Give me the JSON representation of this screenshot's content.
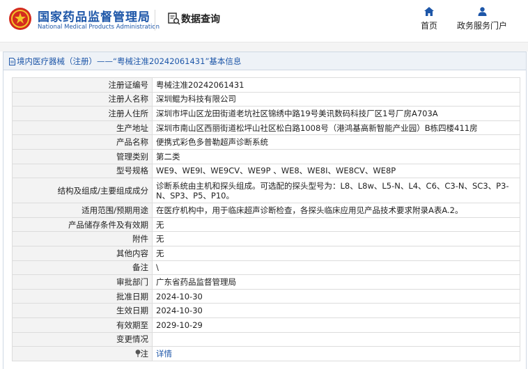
{
  "header": {
    "brand_cn": "国家药品监督管理局",
    "brand_en": "National Medical Products Administration",
    "data_query": "数据查询",
    "nav": [
      {
        "label": "首页",
        "icon": "home-icon"
      },
      {
        "label": "政务服务门户",
        "icon": "user-icon"
      }
    ],
    "accent": "#1d56a8"
  },
  "panel": {
    "title": "境内医疗器械（注册）——“粤械注准20242061431”基本信息"
  },
  "rows": [
    {
      "label": "注册证编号",
      "value": "粤械注准20242061431"
    },
    {
      "label": "注册人名称",
      "value": "深圳鲲为科技有限公司"
    },
    {
      "label": "注册人住所",
      "value": "深圳市坪山区龙田街道老坑社区锦绣中路19号美讯数码科技厂区1号厂房A703A"
    },
    {
      "label": "生产地址",
      "value": "深圳市南山区西丽街道松坪山社区松白路1008号（港鸿基高新智能产业园）B栋四楼411房"
    },
    {
      "label": "产品名称",
      "value": "便携式彩色多普勒超声诊断系统"
    },
    {
      "label": "管理类别",
      "value": "第二类"
    },
    {
      "label": "型号规格",
      "value": "WE9、WE9I、WE9CV、WE9P 、WE8、WE8I、WE8CV、WE8P"
    },
    {
      "label": "结构及组成/主要组成成分",
      "value": "诊断系统由主机和探头组成。可选配的探头型号为：L8、L8w、L5-N、L4、C6、C3-N、SC3、P3-N、SP3、P5、P10。"
    },
    {
      "label": "适用范围/预期用途",
      "value": "在医疗机构中，用于临床超声诊断检查，各探头临床应用见产品技术要求附录A表A.2。"
    },
    {
      "label": "产品储存条件及有效期",
      "value": "无"
    },
    {
      "label": "附件",
      "value": "无"
    },
    {
      "label": "其他内容",
      "value": "无"
    },
    {
      "label": "备注",
      "value": "\\"
    },
    {
      "label": "审批部门",
      "value": "广东省药品监督管理局"
    },
    {
      "label": "批准日期",
      "value": "2024-10-30"
    },
    {
      "label": "生效日期",
      "value": "2024-10-30"
    },
    {
      "label": "有效期至",
      "value": "2029-10-29"
    },
    {
      "label": "变更情况",
      "value": ""
    }
  ],
  "note_row": {
    "label": "注",
    "link": "详情",
    "icon": "pin-icon"
  }
}
